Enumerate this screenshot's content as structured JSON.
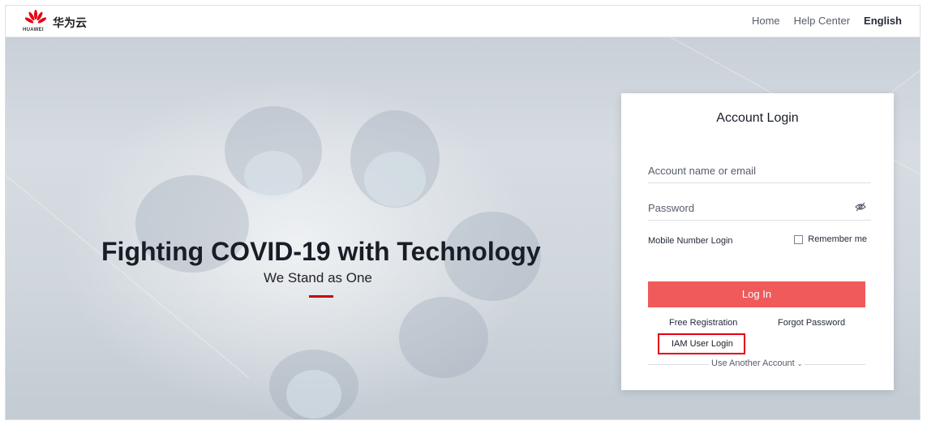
{
  "header": {
    "brand_small": "HUAWEI",
    "brand_cn": "华为云",
    "nav": {
      "home": "Home",
      "help_center": "Help Center",
      "language": "English"
    }
  },
  "hero": {
    "title": "Fighting COVID-19 with Technology",
    "subtitle": "We Stand as One"
  },
  "login": {
    "title": "Account Login",
    "account_placeholder": "Account name or email",
    "password_placeholder": "Password",
    "mobile_login": "Mobile Number Login",
    "remember_me": "Remember me",
    "remember_checked": false,
    "login_button": "Log In",
    "free_registration": "Free Registration",
    "forgot_password": "Forgot Password",
    "iam_user_login": "IAM User Login",
    "use_another_account": "Use Another Account"
  },
  "colors": {
    "accent_red": "#c7000b",
    "login_button": "#f05a5a",
    "highlight_box": "#e60012"
  }
}
